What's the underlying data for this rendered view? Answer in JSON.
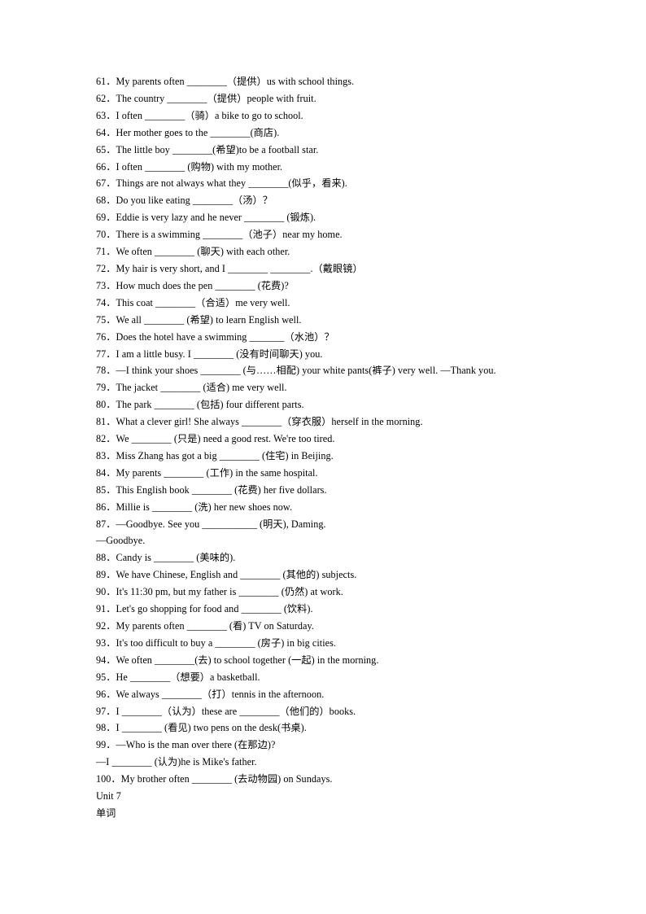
{
  "document": {
    "type": "worksheet",
    "background_color": "#ffffff",
    "text_color": "#000000",
    "items": [
      {
        "num": "61．",
        "text": "My parents often ________（提供）us with school things."
      },
      {
        "num": "62．",
        "text": "The country ________（提供）people with fruit."
      },
      {
        "num": "63．",
        "text": "I often ________（骑）a bike to go to school."
      },
      {
        "num": "64．",
        "text": "Her mother goes to the ________(商店)."
      },
      {
        "num": "65．",
        "text": "The little boy ________(希望)to be a football star."
      },
      {
        "num": "66．",
        "text": "I often ________ (购物) with my mother."
      },
      {
        "num": "67．",
        "text": "Things are not always what they ________(似乎，看来)."
      },
      {
        "num": "68．",
        "text": "Do you like eating ________（汤）？"
      },
      {
        "num": "69．",
        "text": "Eddie is very lazy and he never ________ (锻炼)."
      },
      {
        "num": "70．",
        "text": "There is a swimming ________（池子）near my home."
      },
      {
        "num": "71．",
        "text": "We often ________ (聊天) with each other."
      },
      {
        "num": "72．",
        "text": "My hair is very short, and I ________ ________.（戴眼镜）"
      },
      {
        "num": "73．",
        "text": "How much does the pen ________ (花费)?"
      },
      {
        "num": "74．",
        "text": "This coat ________（合适）me very well."
      },
      {
        "num": "75．",
        "text": "We all ________ (希望) to learn English well."
      },
      {
        "num": "76．",
        "text": "Does the hotel have a swimming _______（水池）？"
      },
      {
        "num": "77．",
        "text": "I am a little busy. I ________ (没有时间聊天) you."
      },
      {
        "num": "78．",
        "text": "—I think your shoes ________ (与……相配) your white pants(裤子) very well. —Thank you."
      },
      {
        "num": "79．",
        "text": "The jacket ________ (适合) me very well."
      },
      {
        "num": "80．",
        "text": "The park ________ (包括) four different parts."
      },
      {
        "num": "81．",
        "text": "What a clever girl! She always ________（穿衣服）herself in the morning."
      },
      {
        "num": "82．",
        "text": "We ________ (只是) need a good rest. We're too tired."
      },
      {
        "num": "83．",
        "text": "Miss Zhang has got a big ________ (住宅) in Beijing."
      },
      {
        "num": "84．",
        "text": "My parents ________ (工作) in the same hospital."
      },
      {
        "num": "85．",
        "text": "This English book ________ (花费) her five dollars."
      },
      {
        "num": "86．",
        "text": "Millie is ________ (洗) her new shoes now."
      },
      {
        "num": "87．",
        "text": "—Goodbye. See you ___________ (明天), Daming."
      },
      {
        "num": "",
        "text": "—Goodbye.",
        "continuation": true
      },
      {
        "num": "88．",
        "text": "Candy is ________ (美味的)."
      },
      {
        "num": "89．",
        "text": "We have Chinese, English and ________ (其他的) subjects."
      },
      {
        "num": "90．",
        "text": "It's 11:30 pm, but my father is ________ (仍然) at work."
      },
      {
        "num": "91．",
        "text": "Let's go shopping for food and ________ (饮料)."
      },
      {
        "num": "92．",
        "text": "My parents often ________ (看) TV on Saturday."
      },
      {
        "num": "93．",
        "text": "It's too difficult to buy a ________ (房子) in big cities."
      },
      {
        "num": "94．",
        "text": "We often ________(去) to school together (一起) in the morning."
      },
      {
        "num": "95．",
        "text": "He ________（想要）a basketball."
      },
      {
        "num": "96．",
        "text": "We always ________（打）tennis in the afternoon."
      },
      {
        "num": "97．",
        "text": "I ________（认为）these are ________（他们的）books."
      },
      {
        "num": "98．",
        "text": "I ________ (看见) two pens on the desk(书桌)."
      },
      {
        "num": "99．",
        "text": "—Who is the man over there (在那边)?"
      },
      {
        "num": "",
        "text": "—I ________ (认为)he is Mike's father.",
        "continuation": true
      },
      {
        "num": "100．",
        "text": "My brother often ________ (去动物园) on Sundays."
      }
    ],
    "footer": {
      "unit_label": "Unit 7",
      "section_label": "单词"
    }
  }
}
